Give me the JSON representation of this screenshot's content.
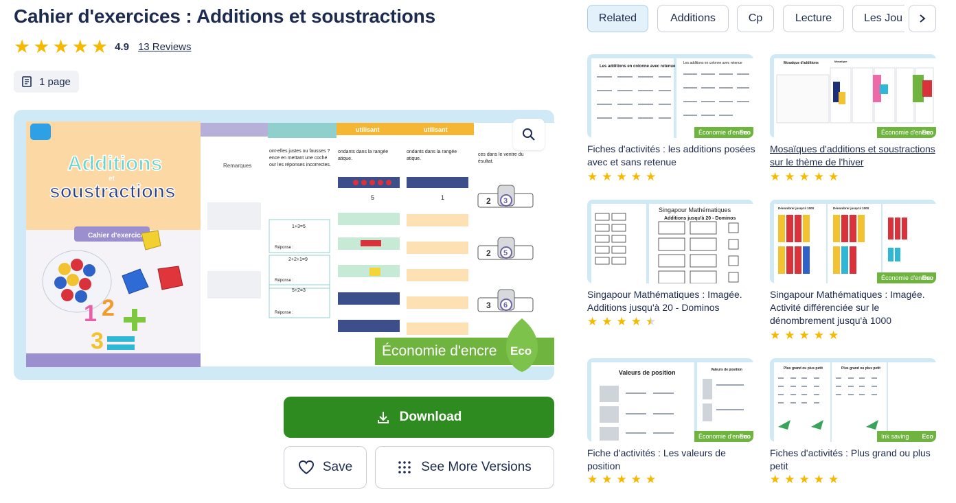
{
  "product": {
    "title": "Cahier d'exercices : Additions et soustractions",
    "rating": "4.9",
    "reviews_label": "13 Reviews",
    "pages_label": "1 page"
  },
  "preview": {
    "cover_word1": "Additions",
    "cover_word_mid": "et",
    "cover_word2": "soustractions",
    "cover_subtitle": "Cahier d'exercices",
    "page_header_1": "Remarques",
    "page_header_2": "utilisant",
    "page_header_3": "utilisant",
    "page_text_1": "ont-elles justes ou fausses ?",
    "page_text_2": "ence en mettant une coche",
    "page_text_3": "our les réponses incorrectes.",
    "page_text_4": "ondants dans la rangée",
    "page_text_5": "atique.",
    "page_text_6": "ondants dans la rangée",
    "page_text_7": "atique.",
    "page_text_8": "ces dans le ventre du",
    "page_text_9": "ésultat.",
    "eq1": "1+3=5",
    "eq2": "2+2+1=9",
    "eq3": "5+2=3",
    "reponse": "Réponse :",
    "robot_nums": [
      "2",
      "3",
      "2",
      "5",
      "3",
      "6"
    ],
    "bar_vals": [
      "5",
      "1"
    ],
    "eco_label": "Économie d'encre",
    "eco_badge": "Eco",
    "cover_nums": [
      "1",
      "2",
      "3"
    ]
  },
  "actions": {
    "download": "Download",
    "save": "Save",
    "more_versions": "See More Versions"
  },
  "tabs": [
    {
      "label": "Related",
      "active": true
    },
    {
      "label": "Additions",
      "active": false
    },
    {
      "label": "Cp",
      "active": false
    },
    {
      "label": "Lecture",
      "active": false
    },
    {
      "label": "Les Jou",
      "active": false
    }
  ],
  "related": [
    {
      "title": "Fiches d'activités : les additions posées avec et sans retenue",
      "stars": 5,
      "eco": "Économie d'encre",
      "eco_badge": "Eco",
      "thumb_title": "Les additions en colonne avec retenue",
      "thumb_title_2": "Les additions en colonne avec retenue"
    },
    {
      "title": "Mosaïques d'additions et soustractions sur le thème de l'hiver",
      "stars": 5,
      "eco": "Économie d'encre",
      "eco_badge": "Eco",
      "thumb_title": "Mosaïque d'additions",
      "thumb_title_2": "Mosaïque"
    },
    {
      "title": "Singapour Mathématiques : Imagée. Additions jusqu'à 20 - Dominos",
      "stars": 4.5,
      "thumb_title": "Singapour Mathématiques",
      "thumb_title_2": "Additions jusqu'à 20 - Dominos"
    },
    {
      "title": "Singapour Mathématiques : Imagée. Activité différenciée sur le dénombrement jusqu'à 1000",
      "stars": 5,
      "eco": "Économie d'encre",
      "eco_badge": "Eco",
      "thumb_title": "Dénombrer jusqu'à 1000",
      "thumb_title_2": "Dénombrer jusqu'à 1000"
    },
    {
      "title": "Fiche d'activités : Les valeurs de position",
      "stars": 5,
      "eco": "Économie d'encre",
      "eco_badge": "Eco",
      "thumb_title": "Valeurs de position",
      "thumb_title_2": "Valeurs de position"
    },
    {
      "title": "Fiches d'activités : Plus grand ou plus petit",
      "stars": 5,
      "eco": "Ink saving",
      "eco_badge": "Eco",
      "thumb_title": "Plus grand ou plus petit",
      "thumb_title_2": "Plus grand ou plus petit"
    }
  ],
  "colors": {
    "primary_green": "#2e8b1f",
    "star": "#f6b800",
    "preview_bg": "#cfe9f6",
    "eco_green": "#6fb43f",
    "tab_active_bg": "#e3f1fb"
  },
  "icons": {
    "zoom": "search-icon",
    "download": "download-icon",
    "save": "heart-icon",
    "versions": "grid-dots-icon",
    "next": "chevron-right-icon",
    "pages": "document-icon"
  }
}
